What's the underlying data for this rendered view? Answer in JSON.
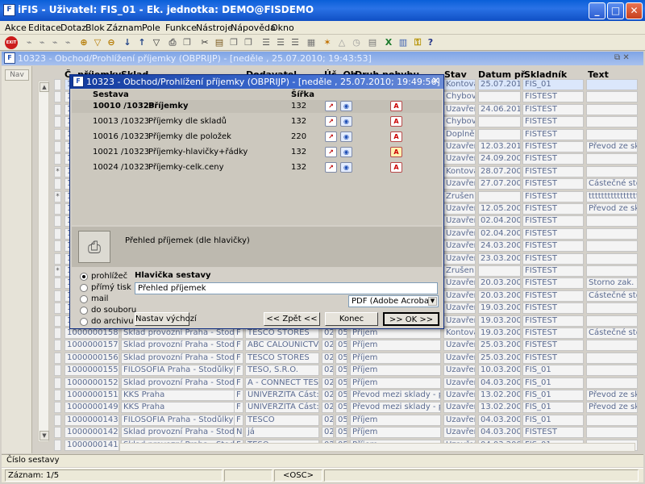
{
  "window": {
    "title": "iFIS - Uživatel: FIS_01 - Ek. jednotka: DEMO@FISDEMO",
    "app_icon": "F",
    "minimize": "_",
    "maximize": "□",
    "close": "✕"
  },
  "menu": [
    "Akce",
    "Editace",
    "Dotaz",
    "Blok",
    "Záznam",
    "Pole",
    "Funkce",
    "Nástroje",
    "Nápověda",
    "Okno"
  ],
  "toolbar": {
    "exit_label": "EXIT",
    "icons": [
      "pin-icon",
      "pin-icon",
      "pin-icon",
      "pin-icon",
      "filter-add-icon",
      "filter-icon",
      "filter-remove-icon",
      "sort-asc-icon",
      "sort-desc-icon",
      "funnel-icon",
      "print-icon",
      "copy-icon",
      "scissors-icon",
      "clipboard-icon",
      "copy-icon",
      "paste-icon",
      "list-icon",
      "list-icon",
      "list-icon",
      "grid-icon",
      "sun-icon",
      "triangle-icon",
      "clock-icon",
      "table-icon",
      "excel-icon",
      "chart-icon",
      "key-icon",
      "help-icon"
    ],
    "help_glyph": "?"
  },
  "mdi": {
    "title": "10323 - Obchod/Prohlížení příjemky (OBPRIJP) - [neděle , 25.07.2010; 19:43:53]",
    "icon": "F",
    "controls": "⧉ ✕",
    "nav_label": "Nav"
  },
  "grid": {
    "headers": {
      "cislo": "Č. příjemky",
      "sklad": "Sklad",
      "dodavatel": "Dodavatel",
      "ucet": "Úč. Ob",
      "druh": "Druh pohybu",
      "stav": "Stav",
      "datum": "Datum př.",
      "skladnik": "Skladník",
      "text": "Text"
    },
    "top_rows": [
      {
        "mark": "",
        "num": "10",
        "stav": "Kontová",
        "datum": "25.07.2010",
        "skladnik": "FIS_01",
        "text": ""
      },
      {
        "mark": "",
        "num": "10",
        "stav": "Chybový",
        "datum": "",
        "skladnik": "FISTEST",
        "text": ""
      },
      {
        "mark": "",
        "num": "10",
        "stav": "Uzavřen",
        "datum": "24.06.2010",
        "skladnik": "FISTEST",
        "text": ""
      },
      {
        "mark": "",
        "num": "10",
        "stav": "Chybový",
        "datum": "",
        "skladnik": "FISTEST",
        "text": ""
      },
      {
        "mark": "",
        "num": "10",
        "stav": "Doplněn",
        "datum": "",
        "skladnik": "FISTEST",
        "text": ""
      },
      {
        "mark": "",
        "num": "10",
        "stav": "Uzavřen",
        "datum": "12.03.2010",
        "skladnik": "FISTEST",
        "text": "Převod ze sklac"
      },
      {
        "mark": "",
        "num": "10",
        "stav": "Uzavřen",
        "datum": "24.09.2009",
        "skladnik": "FISTEST",
        "text": ""
      },
      {
        "mark": "*",
        "num": "10",
        "stav": "Kontová",
        "datum": "28.07.2009",
        "skladnik": "FISTEST",
        "text": ""
      },
      {
        "mark": "",
        "num": "10",
        "stav": "Uzavřen",
        "datum": "27.07.2009",
        "skladnik": "FISTEST",
        "text": "Částečné storno"
      },
      {
        "mark": "*",
        "num": "10",
        "stav": "Zrušen",
        "datum": "",
        "skladnik": "FISTEST",
        "text": "ttttttttttttttttttttt"
      },
      {
        "mark": "",
        "num": "10",
        "stav": "Uzavřen",
        "datum": "12.05.2009",
        "skladnik": "FISTEST",
        "text": "Převod ze sklac"
      },
      {
        "mark": "",
        "num": "10",
        "stav": "Uzavřen",
        "datum": "02.04.2009",
        "skladnik": "FISTEST",
        "text": ""
      },
      {
        "mark": "",
        "num": "10",
        "stav": "Uzavřen",
        "datum": "02.04.2009",
        "skladnik": "FISTEST",
        "text": ""
      },
      {
        "mark": "",
        "num": "10",
        "stav": "Uzavřen",
        "datum": "24.03.2009",
        "skladnik": "FISTEST",
        "text": ""
      },
      {
        "mark": "",
        "num": "10",
        "stav": "Uzavřen",
        "datum": "23.03.2009",
        "skladnik": "FISTEST",
        "text": ""
      },
      {
        "mark": "*",
        "num": "10",
        "stav": "Zrušen",
        "datum": "",
        "skladnik": "FISTEST",
        "text": ""
      },
      {
        "mark": "",
        "num": "10",
        "stav": "Uzavřen",
        "datum": "20.03.2009",
        "skladnik": "FISTEST",
        "text": "Storno zak. výd"
      },
      {
        "mark": "",
        "num": "10",
        "stav": "Uzavřen",
        "datum": "20.03.2009",
        "skladnik": "FISTEST",
        "text": "Částečné storno"
      },
      {
        "mark": "",
        "num": "10",
        "stav": "Uzavřen",
        "datum": "19.03.2009",
        "skladnik": "FISTEST",
        "text": ""
      },
      {
        "mark": "",
        "num": "10",
        "stav": "Uzavřen",
        "datum": "19.03.2009",
        "skladnik": "FISTEST",
        "text": ""
      }
    ],
    "full_rows": [
      {
        "num": "1000000158",
        "sklad": "Sklad provozní Praha - Stodůlky",
        "f": "F",
        "dod": "TESCO STORES",
        "u1": "02",
        "u2": "05",
        "druh": "Příjem",
        "stav": "Kontová",
        "datum": "19.03.2009",
        "skladnik": "FISTEST",
        "text": "Částečné storno"
      },
      {
        "num": "1000000157",
        "sklad": "Sklad provozní Praha - Stodůlky",
        "f": "F",
        "dod": "ABC CALOUNICTVÍ pro",
        "u1": "02",
        "u2": "05",
        "druh": "Příjem",
        "stav": "Uzavřen",
        "datum": "25.03.2009",
        "skladnik": "FISTEST",
        "text": ""
      },
      {
        "num": "1000000156",
        "sklad": "Sklad provozní Praha - Stodůlky",
        "f": "F",
        "dod": "TESCO STORES",
        "u1": "02",
        "u2": "05",
        "druh": "Příjem",
        "stav": "Uzavřen",
        "datum": "25.03.2009",
        "skladnik": "FISTEST",
        "text": ""
      },
      {
        "num": "1000000155",
        "sklad": "FILOSOFIA Praha - Stodůlky",
        "f": "F",
        "dod": "TESO, S.R.O.",
        "u1": "02",
        "u2": "05",
        "druh": "Příjem",
        "stav": "Uzavřen",
        "datum": "10.03.2009",
        "skladnik": "FIS_01",
        "text": ""
      },
      {
        "num": "1000000152",
        "sklad": "Sklad provozní Praha - Stodůlky",
        "f": "F",
        "dod": "A - CONNECT TEST UNI",
        "u1": "02",
        "u2": "05",
        "druh": "Příjem",
        "stav": "Uzavřen",
        "datum": "04.03.2008",
        "skladnik": "FIS_01",
        "text": ""
      },
      {
        "num": "1000000151",
        "sklad": "KKS Praha",
        "f": "F",
        "dod": "UNIVERZITA Část: EkF",
        "u1": "02",
        "u2": "05",
        "druh": "Převod mezi sklady - příjem",
        "stav": "Uzavřen",
        "datum": "13.02.2008",
        "skladnik": "FIS_01",
        "text": "Převod ze sklac"
      },
      {
        "num": "1000000149",
        "sklad": "KKS Praha",
        "f": "F",
        "dod": "UNIVERZITA Část: EkF",
        "u1": "02",
        "u2": "05",
        "druh": "Převod mezi sklady - příjem",
        "stav": "Uzavřen",
        "datum": "13.02.2008",
        "skladnik": "FIS_01",
        "text": "Převod ze sklac"
      },
      {
        "num": "1000000143",
        "sklad": "FILOSOFIA Praha - Stodůlky",
        "f": "F",
        "dod": "TESCO",
        "u1": "02",
        "u2": "05",
        "druh": "Příjem",
        "stav": "Uzavřen",
        "datum": "04.03.2008",
        "skladnik": "FIS_01",
        "text": ""
      },
      {
        "num": "1000000142",
        "sklad": "Sklad provozní Praha - Stodůlky",
        "f": "N",
        "dod": "já",
        "u1": "02",
        "u2": "05",
        "druh": "Příjem",
        "stav": "Uzavřen",
        "datum": "04.03.2008",
        "skladnik": "FISTEST",
        "text": ""
      },
      {
        "num": "1000000141",
        "sklad": "Sklad provozní Praha - Stodůlky",
        "f": "F",
        "dod": "TESO",
        "u1": "02",
        "u2": "05",
        "druh": "Příjem",
        "stav": "Uzavřen",
        "datum": "04.03.2008",
        "skladnik": "FIS_01",
        "text": ""
      }
    ]
  },
  "dialog": {
    "title": "10323 - Obchod/Prohlížení příjemky (OBPRIJP) - [neděle , 25.07.2010; 19:49:56]",
    "icon": "F",
    "close": "✕",
    "col_sestava": "Sestava",
    "col_sirka": "Šířka",
    "reports": [
      {
        "code": "10010 /10323",
        "name": "Příjemky",
        "width": "132",
        "bold": true
      },
      {
        "code": "10013 /10323",
        "name": "Příjemky dle skladů",
        "width": "132",
        "bold": false
      },
      {
        "code": "10016 /10323",
        "name": "Příjemky dle položek",
        "width": "220",
        "bold": false
      },
      {
        "code": "10021 /10323",
        "name": "Příjemky-hlavičky+řádky",
        "width": "132",
        "bold": false
      },
      {
        "code": "10024 /10323",
        "name": "Příjemky-celk.ceny",
        "width": "132",
        "bold": false
      }
    ],
    "description": "Přehled příjemek (dle hlavičky)",
    "outputs": [
      "prohlížeč",
      "přímý tisk",
      "mail",
      "do souboru",
      "do archivu"
    ],
    "header_label": "Hlavička sestavy",
    "header_value": "Přehled příjemek",
    "format_value": "PDF (Adobe Acrobat)",
    "buttons": {
      "reset": "Nastav výchozí",
      "back": "<< Zpět <<",
      "end": "Konec",
      "ok": ">> OK >>"
    }
  },
  "status": {
    "field_label": "Číslo sestavy",
    "record": "Záznam: 1/5",
    "osc": "<OSC>"
  }
}
